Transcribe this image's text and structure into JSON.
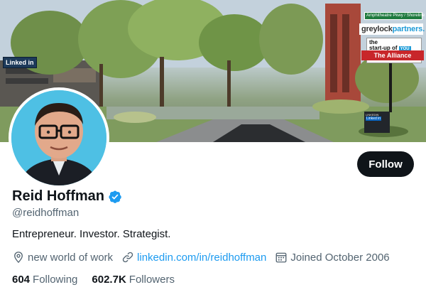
{
  "banner": {
    "linkedin_sign": "Linked in",
    "street_sign": "Amphitheatre Pkwy / Shoreline Bl",
    "greylock_prefix": "greylock",
    "greylock_accent": "partners.",
    "startup_line1": "the",
    "startup_line2": "start-up of",
    "startup_you": "YOU",
    "alliance": "The Alliance",
    "plaque_title": "LINKEDIN",
    "plaque_brand": "Linked in"
  },
  "profile": {
    "display_name": "Reid Hoffman",
    "verified": true,
    "handle": "@reidhoffman",
    "bio": "Entrepreneur. Investor. Strategist.",
    "location": "new world of work",
    "website": "linkedin.com/in/reidhoffman",
    "joined": "Joined October 2006"
  },
  "actions": {
    "follow_label": "Follow"
  },
  "stats": {
    "following_count": "604",
    "following_label": "Following",
    "followers_count": "602.7K",
    "followers_label": "Followers"
  },
  "icons": {
    "location": "location-pin-icon",
    "link": "link-icon",
    "calendar": "calendar-icon",
    "verified": "verified-badge-icon"
  },
  "colors": {
    "text_primary": "#0f1419",
    "text_secondary": "#536471",
    "accent": "#1d9bf0",
    "follow_bg": "#0f1419",
    "follow_text": "#ffffff"
  }
}
